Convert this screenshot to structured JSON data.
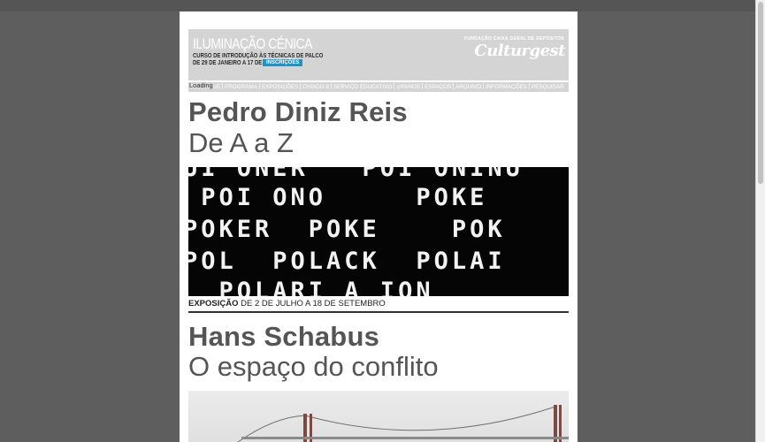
{
  "banner": {
    "title": "ILUMINAÇÃO CÉNICA",
    "subtitle": "CURSO DE INTRODUÇÃO ÀS TÉCNICAS DE PALCO",
    "dates": "DE 29 DE JANEIRO A 17 DE JULHO",
    "button_label": "INSCRIÇÕES",
    "foundation": "FUNDAÇÃO CAIXA GERAL DE DEPÓSITOS",
    "logo": "Culturgest"
  },
  "nav": {
    "items": [
      {
        "label": "DESTAQUE"
      },
      {
        "label": "PROGRAMA"
      },
      {
        "label": "EXPOSIÇÕES"
      },
      {
        "label": "CHIADO 8"
      },
      {
        "label": "SERVIÇO EDUCATIVO"
      },
      {
        "label": "PANOS"
      },
      {
        "label": "ESPAÇOS"
      },
      {
        "label": "ARQUIVO"
      },
      {
        "label": "INFORMAÇÕES"
      },
      {
        "label": "PESQUISAR"
      }
    ]
  },
  "status": {
    "loading": "Loading"
  },
  "items": [
    {
      "artist": "Pedro Diniz Reis",
      "title": "De A a Z",
      "caption_label": "EXPOSIÇÃO",
      "caption_dates": " DE 2 DE JULHO A 18 DE SETEMBRO",
      "artwork_rows": [
        "UI ONER   POI ONINU",
        " POI ONO     POKE",
        "POKER  POKE    POK",
        "POL  POLACK  POLAI",
        "  POLARI A ION"
      ]
    },
    {
      "artist": "Hans Schabus",
      "title": "O espaço do conflito"
    }
  ],
  "colors": {
    "background": "#5e5e5e",
    "banner": "#d4d4d4",
    "accent": "#1e93c9",
    "text": "#555555"
  }
}
